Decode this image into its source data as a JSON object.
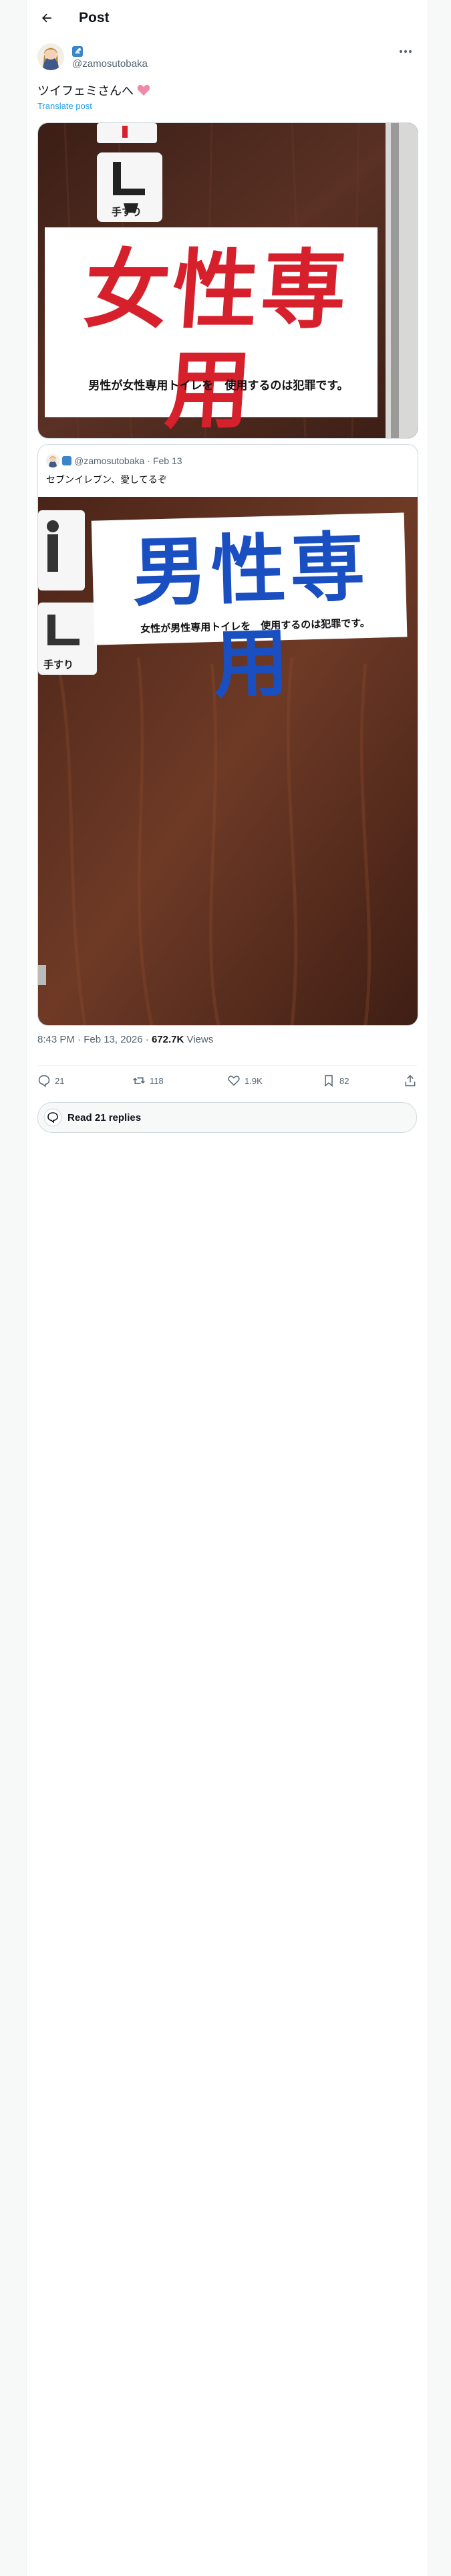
{
  "header": {
    "title": "Post"
  },
  "post": {
    "handle": "@zamosutobaka",
    "text": "ツイフェミさんへ",
    "translate_label": "Translate post",
    "image": {
      "small_sign_label": "手すり",
      "sign_main": "女性専用",
      "sign_sub": "男性が女性専用トイレを　使用するのは犯罪です。",
      "sign_color": "#d6202c"
    },
    "quote": {
      "handle": "@zamosutobaka",
      "date": "Feb 13",
      "text": "セブンイレブン、愛してるぞ",
      "image": {
        "small_sign_label": "手すり",
        "sign_main": "男性専用",
        "sign_sub": "女性が男性専用トイレを　使用するのは犯罪です。",
        "sign_color": "#1a4fc2"
      }
    },
    "time": "8:43 PM · Feb 13, 2026 · ",
    "views_count": "672.7K",
    "views_label": " Views",
    "stats": {
      "replies": "21",
      "reposts": "118",
      "likes": "1.9K",
      "bookmarks": "82"
    },
    "read_replies_label": "Read 21 replies"
  },
  "colors": {
    "accent": "#1d9bf0",
    "door": "#4a2a20"
  }
}
